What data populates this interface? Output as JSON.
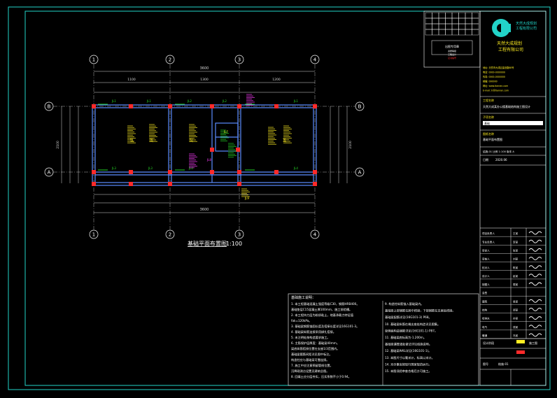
{
  "plan": {
    "title": "基础平面布置图",
    "scale": "1:100",
    "grid_cols": [
      "1",
      "2",
      "3",
      "4"
    ],
    "grid_rows": [
      "B",
      "A"
    ],
    "dim_total": "3600",
    "dim_spans": [
      "1100",
      "1300",
      "1200"
    ],
    "dim_depth": "2100",
    "beam_labels_top": [
      "JL1",
      "JL1",
      "JL2",
      "JL2",
      "JL1"
    ],
    "beam_labels_bottom": [
      "JL3",
      "JL3",
      "JL4",
      "JL4"
    ],
    "beam_labels_vertical": [
      "JL5",
      "JL6",
      "JL5",
      "JL6"
    ],
    "center_labels": [
      "JL7",
      "JL8",
      "JL9"
    ]
  },
  "notes": {
    "header": "基础施工说明：",
    "left": [
      "1. 本工程基础混凝土强度等级C30，钢筋HRB400。",
      "   基础垫层C15混凝土厚100mm，施工前验槽。",
      "2. 本工程持力层为粉质粘土，地基承载力特征值",
      "   fak=120kPa。",
      "3. 基础梁钢筋锚固长度及搭接长度详见16G101-3。",
      "4. 基础梁纵筋连接采用绑扎搭接。",
      "5. 未注明处按构造要求施工。",
      "6. 主筋保护层厚度：基础梁40mm。",
      "   梁底纵筋搭接位置在支座1/3范围内。",
      "   基础梁箍筋间距详见图中标注。",
      "   构造柱应与基础梁可靠连接。",
      "7. 施工中应注意预留管线位置。",
      "   沉降观测点设置见建筑总图。",
      "8. 回填土应分层夯实，压实系数不小于0.94。"
    ],
    "right": [
      "9. 构造柱纵筋锚入基础梁内。",
      "   基础梁上部钢筋在跨中搭接，下部钢筋在支座处搭接。",
      "   基础梁配筋详见(16G101-3) P68。",
      "10. 基础梁纵筋在端支座处构造详见图集。",
      "   梁侧面构造钢筋详见(16G101-1) P87。",
      "11. 基础梁底标高为-1.200m。",
      "   基础梁遇管道处做法详见结施说明。",
      "12. 基础梁WKL详见(16G101-1)。",
      "13. 本图尺寸以毫米计，标高以米计。",
      "14. 未尽事宜按现行国家规范执行。",
      "15. 本图须经审查合格后方可施工。"
    ]
  },
  "title_block": {
    "company_name_1": "天然大成规划",
    "company_name_2": "工程有限公司",
    "company_tag_1": "天然大成规划",
    "company_tag_2": "工程有限公司",
    "cert_lines": [
      "资质等级",
      "工程设计",
      "证书编号"
    ],
    "cert_stamp": "出图专用章",
    "info_lines": [
      "地址: 天然市大成区建设路88号",
      "电话: 0000-0000000",
      "传真: 0000-0000000",
      "邮编: 000000",
      "网址: www.tianran.com",
      "E-mail: tr@tianran.com"
    ],
    "project_label": "工程名称",
    "project_name": "天然大成某办公楼基础结构施工图设计",
    "sub_project_label": "子项名称",
    "sub_project": "基础",
    "drawing_label": "图纸名称",
    "drawing_name": "基础平面布置图",
    "sheet_info": "结施-01  比例 1:100  版本 A",
    "date_label": "日期",
    "date_value": "2020.06",
    "sign_roles": [
      "项目负责人",
      "专业负责人",
      "审定人",
      "审核人",
      "校对人",
      "设计人",
      "制图人",
      "会签",
      "建筑",
      "结构",
      "给排水",
      "电气",
      "暖通"
    ],
    "sign_names": [
      "王某",
      "李某",
      "张某",
      "刘某",
      "陈某",
      "赵某",
      "周某",
      "",
      "吴某",
      "郑某",
      "孙某",
      "钱某",
      "冯某"
    ],
    "phase_label": "设计阶段",
    "phase_value": "施工图",
    "number_label": "图号",
    "number_value": "结施-01"
  },
  "colors": {
    "frame": "#22d3c8",
    "grid": "#d8d8d8",
    "wall": "#5b8cff",
    "column": "#ff2a2a",
    "beam_text_green": "#25d625",
    "beam_text_yellow": "#ffee22",
    "magenta": "#ff3cff",
    "white": "#ffffff"
  }
}
